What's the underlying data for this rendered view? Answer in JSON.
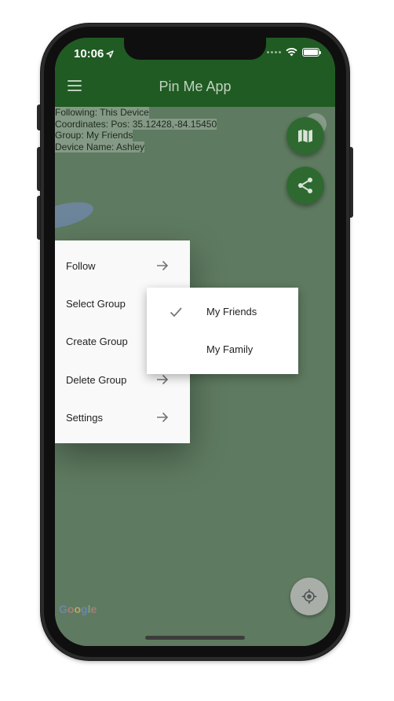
{
  "status_bar": {
    "time": "10:06"
  },
  "app_bar": {
    "title": "Pin Me App"
  },
  "info": {
    "following": "Following: This Device",
    "coordinates": "Coordinates: Pos: 35.12428,-84.15450",
    "group": "Group: My Friends",
    "device_name": "Device Name: Ashley"
  },
  "menu": {
    "items": [
      {
        "label": "Follow",
        "has_arrow": true
      },
      {
        "label": "Select Group",
        "has_arrow": false
      },
      {
        "label": "Create Group",
        "has_arrow": false
      },
      {
        "label": "Delete Group",
        "has_arrow": true
      },
      {
        "label": "Settings",
        "has_arrow": true
      }
    ]
  },
  "submenu": {
    "items": [
      {
        "label": "My Friends",
        "checked": true
      },
      {
        "label": "My Family",
        "checked": false
      }
    ]
  },
  "map": {
    "attribution_letters": [
      "G",
      "o",
      "o",
      "g",
      "l",
      "e"
    ]
  },
  "colors": {
    "app_bar": "#1f5b22",
    "fab": "#2e6a30",
    "map_dim": "#5e7a60"
  },
  "icons": {
    "menu": "hamburger-icon",
    "map_fab": "map-icon",
    "share_fab": "share-icon",
    "locate": "my-location-icon"
  }
}
